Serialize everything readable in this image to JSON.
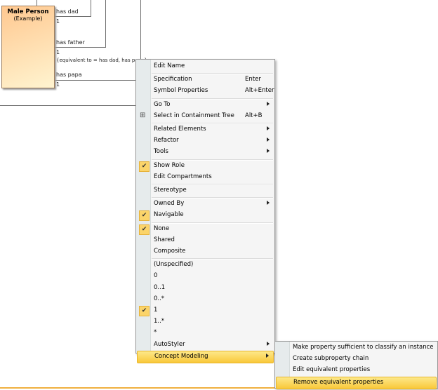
{
  "diagram": {
    "class_name": "Male Person",
    "class_stereo": "(Example)",
    "assoc": [
      {
        "role": "has dad",
        "mult": "1"
      },
      {
        "role": "has father",
        "mult": "1"
      },
      {
        "role": "has papa",
        "mult": "1"
      }
    ],
    "constraint": "{equivalent to = has dad, has papa}"
  },
  "menu": {
    "items": [
      {
        "label": "Edit Name"
      },
      {
        "sep": true
      },
      {
        "label": "Specification",
        "shortcut": "Enter"
      },
      {
        "label": "Symbol Properties",
        "shortcut": "Alt+Enter"
      },
      {
        "sep": true
      },
      {
        "label": "Go To",
        "submenu": true
      },
      {
        "label": "Select in Containment Tree",
        "shortcut": "Alt+B",
        "icon": "containment-tree-icon"
      },
      {
        "sep": true
      },
      {
        "label": "Related Elements",
        "submenu": true
      },
      {
        "label": "Refactor",
        "submenu": true
      },
      {
        "label": "Tools",
        "submenu": true
      },
      {
        "sep": true
      },
      {
        "label": "Show Role",
        "checked": true
      },
      {
        "label": "Edit Compartments"
      },
      {
        "sep": true
      },
      {
        "label": "Stereotype"
      },
      {
        "sep": true
      },
      {
        "label": "Owned By",
        "submenu": true
      },
      {
        "label": "Navigable",
        "checked": true
      },
      {
        "sep": true
      },
      {
        "label": "None",
        "checked": true
      },
      {
        "label": "Shared"
      },
      {
        "label": "Composite"
      },
      {
        "sep": true
      },
      {
        "label": "(Unspecified)"
      },
      {
        "label": "0"
      },
      {
        "label": "0..1"
      },
      {
        "label": "0..*"
      },
      {
        "label": "1",
        "checked": true
      },
      {
        "label": "1..*"
      },
      {
        "label": "*"
      },
      {
        "label": "AutoStyler",
        "submenu": true
      },
      {
        "label": "Concept Modeling",
        "submenu": true,
        "highlighted": true
      }
    ]
  },
  "submenu": {
    "items": [
      {
        "label": "Make property sufficient to classify an instance"
      },
      {
        "label": "Create subproperty chain"
      },
      {
        "label": "Edit equivalent properties"
      },
      {
        "label": "Remove equivalent properties",
        "highlighted": true
      }
    ]
  }
}
